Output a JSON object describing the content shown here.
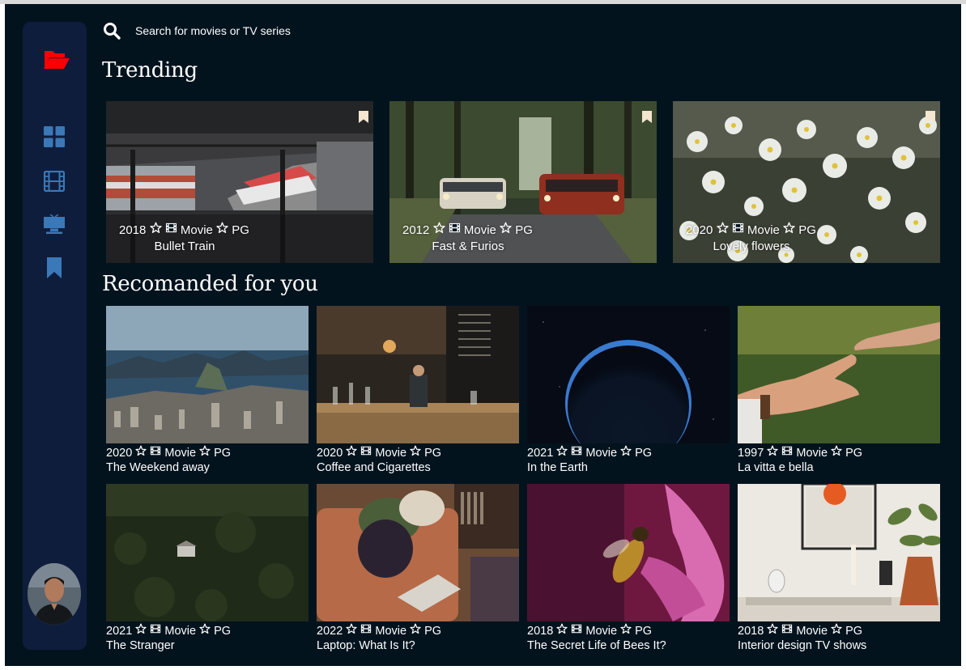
{
  "colors": {
    "background": "#03131e",
    "sidebar": "#0f1d3c",
    "nav_icon": "#3b78b8",
    "logo": "#fc0000",
    "text": "#ffffff"
  },
  "icons": {
    "logo": "folder-open-icon",
    "nav": [
      "grid-icon",
      "film-icon",
      "tv-icon",
      "bookmark-icon"
    ],
    "search": "search-icon",
    "meta": [
      "star-icon",
      "film-icon",
      "star-icon"
    ]
  },
  "search": {
    "placeholder": "Search for movies or TV series"
  },
  "trending": {
    "heading": "Trending",
    "items": [
      {
        "year": "2018",
        "category": "Movie",
        "rating": "PG",
        "title": "Bullet Train"
      },
      {
        "year": "2012",
        "category": "Movie",
        "rating": "PG",
        "title": "Fast & Furios"
      },
      {
        "year": "2020",
        "category": "Movie",
        "rating": "PG",
        "title": "Lovely flowers"
      }
    ]
  },
  "recommended": {
    "heading": "Recomanded for you",
    "items": [
      {
        "year": "2020",
        "category": "Movie",
        "rating": "PG",
        "title": "The Weekend away"
      },
      {
        "year": "2020",
        "category": "Movie",
        "rating": "PG",
        "title": "Coffee and Cigarettes"
      },
      {
        "year": "2021",
        "category": "Movie",
        "rating": "PG",
        "title": "In the Earth"
      },
      {
        "year": "1997",
        "category": "Movie",
        "rating": "PG",
        "title": "La vitta e bella"
      },
      {
        "year": "2021",
        "category": "Movie",
        "rating": "PG",
        "title": "The Stranger"
      },
      {
        "year": "2022",
        "category": "Movie",
        "rating": "PG",
        "title": "Laptop: What Is It?"
      },
      {
        "year": "2018",
        "category": "Movie",
        "rating": "PG",
        "title": "The Secret Life of Bees It?"
      },
      {
        "year": "2018",
        "category": "Movie",
        "rating": "PG",
        "title": "Interior design TV shows"
      }
    ]
  }
}
